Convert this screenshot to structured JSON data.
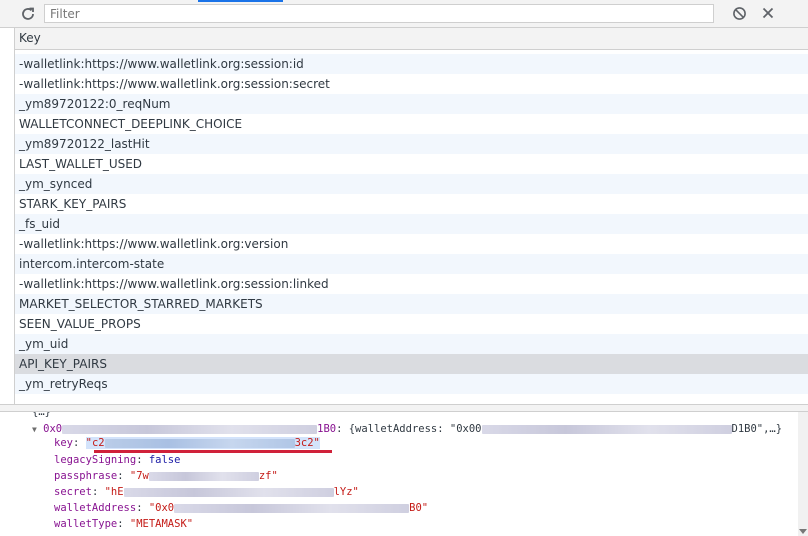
{
  "toolbar": {
    "filter_placeholder": "Filter",
    "icons": [
      "refresh-icon",
      "clear-icon",
      "close-icon"
    ]
  },
  "table": {
    "column_key": "Key",
    "rows": [
      "-walletlink:https://www.walletlink.org:session:id",
      "-walletlink:https://www.walletlink.org:session:secret",
      "_ym89720122:0_reqNum",
      "WALLETCONNECT_DEEPLINK_CHOICE",
      "_ym89720122_lastHit",
      "LAST_WALLET_USED",
      "_ym_synced",
      "STARK_KEY_PAIRS",
      "_fs_uid",
      "-walletlink:https://www.walletlink.org:version",
      "intercom.intercom-state",
      "-walletlink:https://www.walletlink.org:session:linked",
      "MARKET_SELECTOR_STARRED_MARKETS",
      "SEEN_VALUE_PROPS",
      "_ym_uid",
      "API_KEY_PAIRS",
      "_ym_retryReqs"
    ],
    "selected_row": "API_KEY_PAIRS"
  },
  "preview": {
    "top_partial": "{…}",
    "object_key_prefix": "0x0",
    "object_key_suffix": "1B0",
    "object_summary_start": ": {walletAddress: \"0x00",
    "object_summary_end": "D1B0\",…}",
    "key_label": "key",
    "key_value_start": "\"c2",
    "key_value_end": "3c2\"",
    "legacy_label": "legacySigning",
    "legacy_value": "false",
    "passphrase_label": "passphrase",
    "passphrase_start": "\"7w",
    "passphrase_end": "zf\"",
    "secret_label": "secret",
    "secret_start": "\"hE",
    "secret_end": "lYz\"",
    "wallet_label": "walletAddress",
    "wallet_start": "\"0x0",
    "wallet_end": "B0\"",
    "wallettype_label": "walletType",
    "wallettype_value": "\"METAMASK\""
  },
  "colors": {
    "selection_underline": "#d0213a",
    "tab_indicator": "#1a73e8"
  }
}
